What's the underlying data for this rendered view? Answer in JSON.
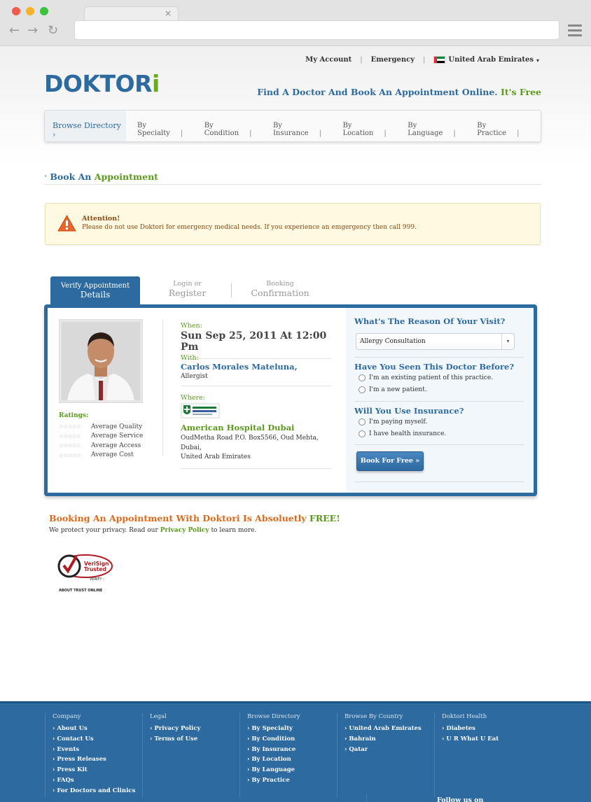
{
  "browser": {
    "tab_close": "×",
    "back": "←",
    "forward": "→",
    "reload": "↻"
  },
  "toplinks": {
    "my_account": "My Account",
    "emergency": "Emergency",
    "country": "United Arab Emirates"
  },
  "logo": {
    "main": "DOKTOR",
    "accent": "i"
  },
  "tagline": {
    "text": "Find A Doctor And Book An Appointment Online.",
    "free": "It's Free"
  },
  "nav": {
    "browse": "Browse Directory ›",
    "items": [
      "By Specialty",
      "By Condition",
      "By Insurance",
      "By Location",
      "By Language",
      "By Practice"
    ]
  },
  "section": {
    "title_a": "Book An",
    "title_b": "Appointment"
  },
  "attention": {
    "title": "Attention!",
    "text": "Please do not use Doktori for emergency medical needs. If you experience an emgergency then call 999."
  },
  "steps": {
    "active": {
      "line1": "Verify Appointment",
      "line2": "Details"
    },
    "login": {
      "line1": "Login or",
      "line2": "Register"
    },
    "booking": {
      "line1": "Booking",
      "line2": "Confirmation"
    }
  },
  "doctor": {
    "ratings_title": "Ratings:",
    "ratings": [
      "Average Quality",
      "Average Service",
      "Average Access",
      "Average Cost"
    ],
    "when_label": "When:",
    "when_value": "Sun Sep 25, 2011 At 12:00 Pm",
    "with_label": "With:",
    "name": "Carlos Morales Mateluna,",
    "specialty": "Allergist",
    "where_label": "Where:",
    "hospital": "American Hospital Dubai",
    "address1": "OudMetha Road P.O. Box5566, Oud Mehta, Dubai,",
    "address2": "United Arab Emirates"
  },
  "form": {
    "reason_q": "What's The Reason Of Your Visit?",
    "reason_value": "Allergy Consultation",
    "seen_q": "Have You Seen This Doctor Before?",
    "seen_opt1": "I'm an existing patient of this practice.",
    "seen_opt2": "I'm a new patient.",
    "ins_q": "Will You Use Insurance?",
    "ins_opt1": "I'm paying myself.",
    "ins_opt2": "I have health insurance.",
    "book_button": "Book For Free »"
  },
  "free_section": {
    "title": "Booking An Appointment With Doktori Is Absoluetly",
    "free": "FREE!",
    "privacy_pre": "We protect your privacy. Read our",
    "privacy_link": "Privacy Policy",
    "privacy_post": "to learn more."
  },
  "verisign": {
    "line1": "VeriSign",
    "line2": "Trusted",
    "verify": "VERIFY ›",
    "about": "ABOUT TRUST ONLINE"
  },
  "footer": {
    "company": {
      "title": "Company",
      "items": [
        "About Us",
        "Contact Us",
        "Events",
        "Press Releases",
        "Press Kit",
        "FAQs",
        "For Doctors and Clinics"
      ]
    },
    "legal": {
      "title": "Legal",
      "items": [
        "Privacy Policy",
        "Terms of Use"
      ]
    },
    "browse": {
      "title": "Browse Directory",
      "items": [
        "By Specialty",
        "By Condition",
        "By Insurance",
        "By Location",
        "By Language",
        "By Practice"
      ]
    },
    "country": {
      "title": "Browse By Country",
      "items": [
        "United Arab Emirates",
        "Bahrain",
        "Qatar"
      ]
    },
    "health": {
      "title": "Doktori Health",
      "items": [
        "Diabetes",
        "U R What U Eat"
      ]
    },
    "follow": "Follow us on"
  },
  "colors": {
    "brand_blue": "#2c6aa0",
    "brand_green": "#5b9a1d",
    "accent_orange": "#e06a1b"
  }
}
